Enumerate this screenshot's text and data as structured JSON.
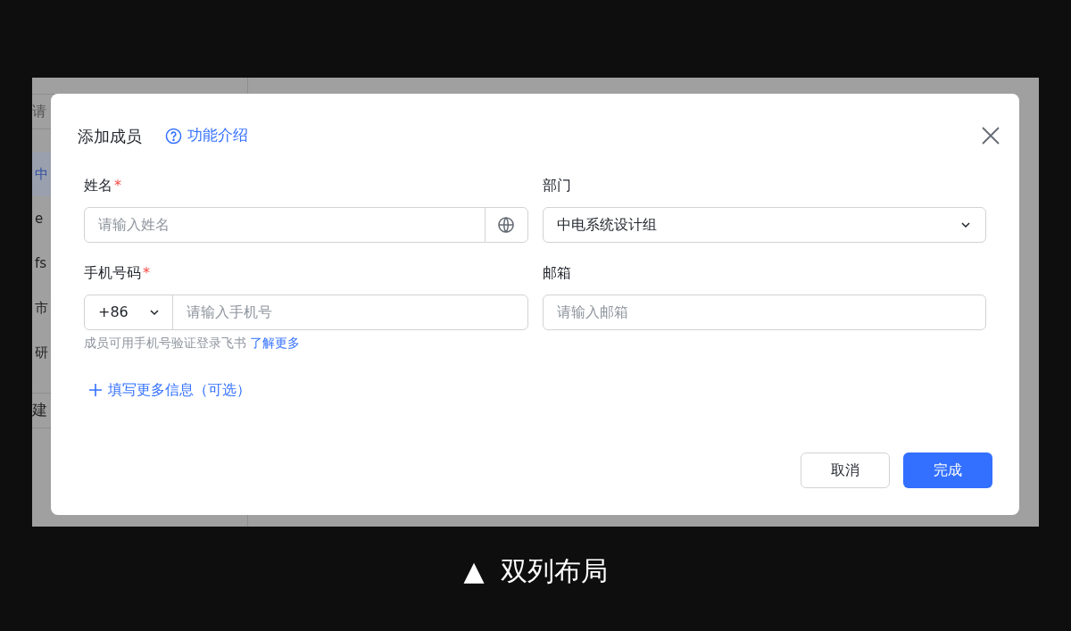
{
  "background": {
    "search": {
      "placeholder": "请"
    },
    "items": [
      {
        "label": "中",
        "selected": true
      },
      {
        "label": "e",
        "selected": false
      },
      {
        "label": "fs",
        "selected": false
      },
      {
        "label": "市",
        "selected": false
      },
      {
        "label": "研",
        "selected": false
      }
    ],
    "create_button": "建"
  },
  "dialog": {
    "title": "添加成员",
    "help_link": "功能介绍",
    "fields": [
      {
        "kind": "text",
        "label": "姓名",
        "required_mark": "*",
        "placeholder": "请输入姓名",
        "has_globe": true
      },
      {
        "kind": "select",
        "label": "部门",
        "value": "中电系统设计组"
      },
      {
        "kind": "phone",
        "label": "手机号码",
        "required_mark": "*",
        "code": "+86",
        "placeholder": "请输入手机号",
        "hint": "成员可用手机号验证登录飞书",
        "hint_link": "了解更多"
      },
      {
        "kind": "text",
        "label": "邮箱",
        "placeholder": "请输入邮箱",
        "has_globe": false
      }
    ],
    "more_link": "填写更多信息（可选）",
    "cancel": "取消",
    "confirm": "完成"
  },
  "caption": {
    "mark": "▲",
    "text": "双列布局"
  }
}
